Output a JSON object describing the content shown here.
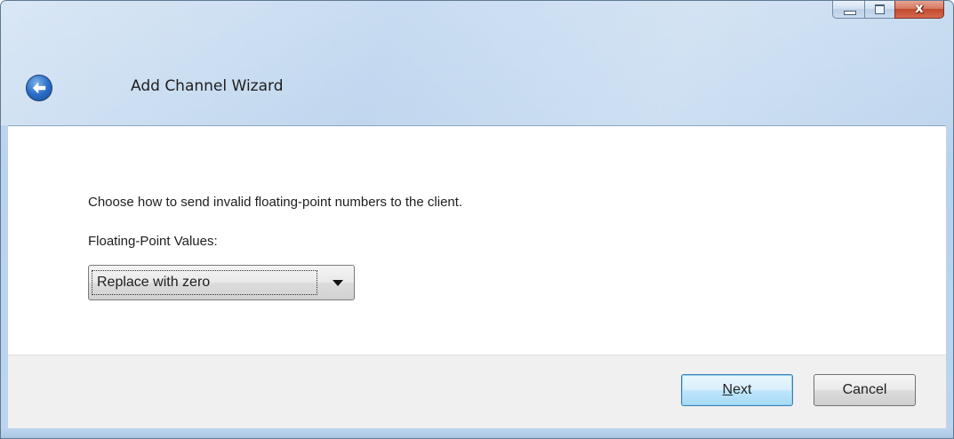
{
  "window": {
    "title": "Add Channel Wizard",
    "caption_buttons": [
      "minimize-icon",
      "maximize-icon",
      "close-icon"
    ],
    "close_glyph": "x"
  },
  "main": {
    "instruction": "Choose how to send invalid floating-point numbers to the client.",
    "field_label": "Floating-Point Values:",
    "select": {
      "selected": "Replace with zero"
    }
  },
  "footer": {
    "next_mnemonic": "N",
    "next_rest": "ext",
    "cancel_label": "Cancel"
  },
  "colors": {
    "frame": "#bcd4ee",
    "close_button": "#c2492f",
    "default_button_border": "#3c7fb1"
  }
}
